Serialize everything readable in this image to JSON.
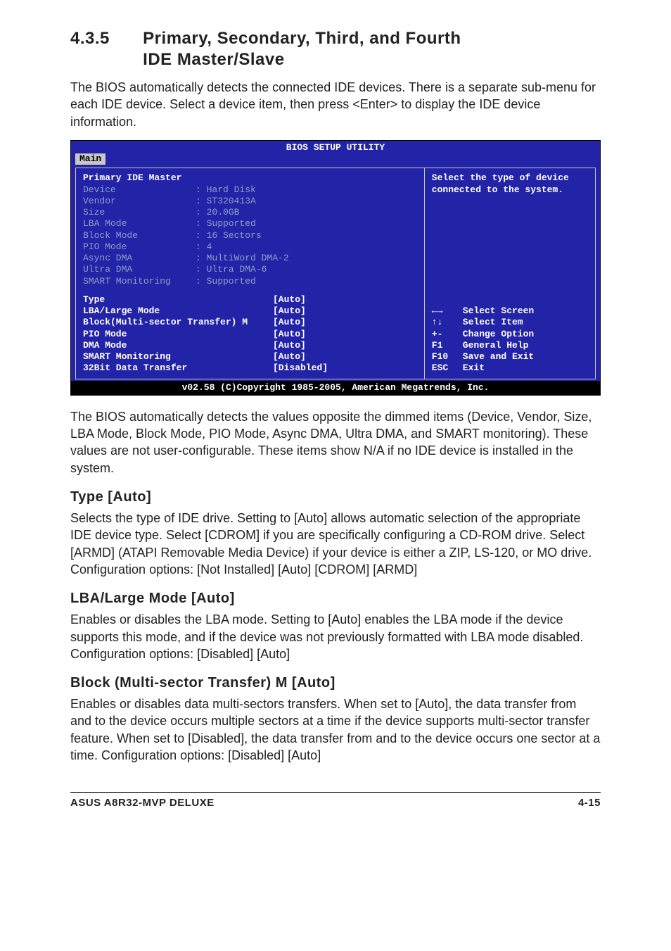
{
  "section": {
    "number": "4.3.5",
    "title_line1": "Primary, Secondary, Third, and Fourth",
    "title_line2": "IDE Master/Slave"
  },
  "intro": "The BIOS automatically detects the connected IDE devices. There is a separate sub-menu for each IDE device. Select a device item, then press <Enter> to display the IDE device information.",
  "bios": {
    "title": "BIOS SETUP UTILITY",
    "tab": "Main",
    "panel_title": "Primary IDE Master",
    "info_rows": [
      {
        "label": "Device",
        "value": ": Hard Disk"
      },
      {
        "label": "Vendor",
        "value": ": ST320413A"
      },
      {
        "label": "Size",
        "value": ": 20.0GB"
      },
      {
        "label": "LBA Mode",
        "value": ": Supported"
      },
      {
        "label": "Block Mode",
        "value": ": 16 Sectors"
      },
      {
        "label": "PIO Mode",
        "value": ": 4"
      },
      {
        "label": "Async DMA",
        "value": ": MultiWord DMA-2"
      },
      {
        "label": "Ultra DMA",
        "value": ": Ultra DMA-6"
      },
      {
        "label": "SMART Monitoring",
        "value": ": Supported"
      }
    ],
    "option_rows": [
      {
        "label": "Type",
        "value": "[Auto]"
      },
      {
        "label": "LBA/Large Mode",
        "value": "[Auto]"
      },
      {
        "label": "Block(Multi-sector Transfer) M",
        "value": "[Auto]"
      },
      {
        "label": "PIO Mode",
        "value": "[Auto]"
      },
      {
        "label": "DMA Mode",
        "value": "[Auto]"
      },
      {
        "label": "SMART Monitoring",
        "value": "[Auto]"
      },
      {
        "label": "32Bit Data Transfer",
        "value": "[Disabled]"
      }
    ],
    "help_text": "Select the type of device connected to the system.",
    "legend": [
      {
        "key": "←→",
        "desc": "Select Screen"
      },
      {
        "key": "↑↓",
        "desc": "Select Item"
      },
      {
        "key": "+-",
        "desc": "Change Option"
      },
      {
        "key": "F1",
        "desc": "General Help"
      },
      {
        "key": "F10",
        "desc": "Save and Exit"
      },
      {
        "key": "ESC",
        "desc": "Exit"
      }
    ],
    "footer": "v02.58 (C)Copyright 1985-2005, American Megatrends, Inc."
  },
  "after_bios": "The BIOS automatically detects the values opposite the dimmed items (Device, Vendor, Size, LBA Mode, Block Mode, PIO Mode, Async DMA, Ultra DMA, and SMART monitoring). These values are not user-configurable. These items show N/A if no IDE device is installed in the system.",
  "type_heading": "Type [Auto]",
  "type_body": "Selects the type of IDE drive. Setting to [Auto] allows automatic selection of the appropriate IDE device type. Select [CDROM] if you are specifically configuring a CD-ROM drive. Select [ARMD] (ATAPI Removable Media Device) if your device is either a ZIP, LS-120, or MO drive. Configuration options: [Not Installed] [Auto] [CDROM] [ARMD]",
  "lba_heading": "LBA/Large Mode [Auto]",
  "lba_body": "Enables or disables the LBA mode. Setting to [Auto] enables the LBA mode if the device supports this mode, and if the device was not previously formatted with LBA mode disabled. Configuration options: [Disabled] [Auto]",
  "block_heading": "Block (Multi-sector Transfer) M [Auto]",
  "block_body": "Enables or disables data multi-sectors transfers. When set to [Auto], the data transfer from and to the device occurs multiple sectors at a time if the device supports multi-sector transfer feature. When set to [Disabled], the data transfer from and to the device occurs one sector at a time. Configuration options: [Disabled] [Auto]",
  "footer_left": "ASUS A8R32-MVP DELUXE",
  "footer_right": "4-15"
}
